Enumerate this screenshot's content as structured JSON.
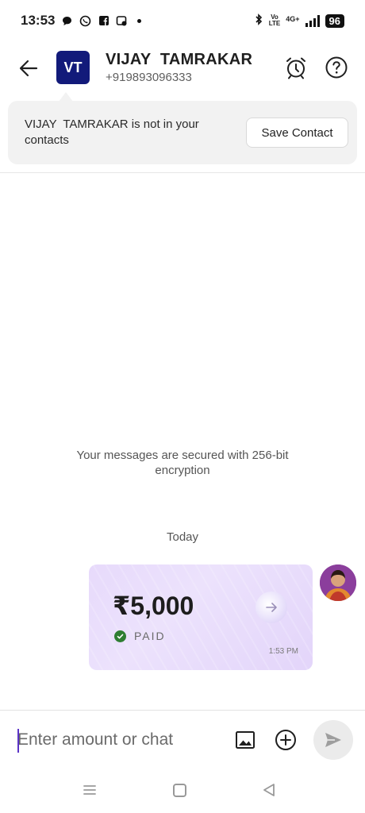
{
  "status_bar": {
    "time": "13:53",
    "network": "4G+",
    "volte": "Vo\nLTE",
    "battery": "96"
  },
  "header": {
    "avatar_initials": "VT",
    "name": "VIJAY  TAMRAKAR",
    "phone": "+919893096333"
  },
  "banner": {
    "text": "VIJAY  TAMRAKAR is not in your contacts",
    "button_label": "Save Contact"
  },
  "messages": {
    "encryption_note": "Your messages are secured with 256-bit encryption",
    "date_separator": "Today",
    "payment": {
      "amount": "₹5,000",
      "status": "PAID",
      "time": "1:53 PM"
    }
  },
  "composer": {
    "placeholder": "Enter amount or chat",
    "value": ""
  },
  "colors": {
    "avatar_bg": "#121a7a",
    "card_bg": "#e7dafb",
    "paid_check": "#2e7d32",
    "caret": "#5b34c7"
  },
  "icons": [
    "back-arrow-icon",
    "alarm-icon",
    "help-icon",
    "image-icon",
    "add-circle-icon",
    "send-icon",
    "check-circle-icon",
    "arrow-right-icon"
  ]
}
